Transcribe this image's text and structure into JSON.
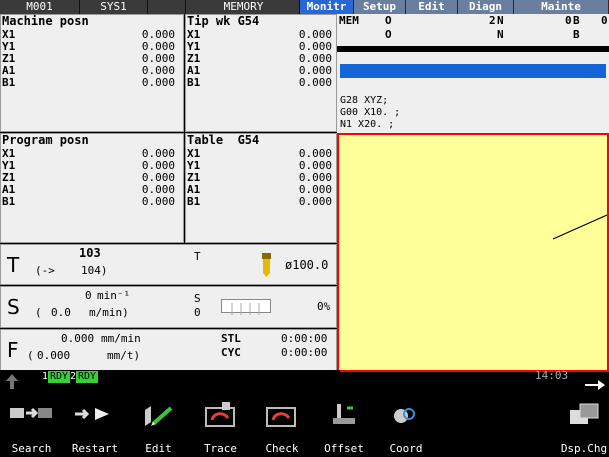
{
  "topbar": {
    "m_code": "M001",
    "sys": "SYS1",
    "memory": "MEMORY",
    "tabs": [
      "Monitr",
      "Setup",
      "Edit",
      "Diagn",
      "Mainte"
    ]
  },
  "machine_posn": {
    "title": "Machine posn",
    "rows": [
      {
        "axis": "X1",
        "value": "0.000"
      },
      {
        "axis": "Y1",
        "value": "0.000"
      },
      {
        "axis": "Z1",
        "value": "0.000"
      },
      {
        "axis": "A1",
        "value": "0.000"
      },
      {
        "axis": "B1",
        "value": "0.000"
      }
    ]
  },
  "tip_wk": {
    "title": "Tip wk G54",
    "rows": [
      {
        "axis": "X1",
        "value": "0.000"
      },
      {
        "axis": "Y1",
        "value": "0.000"
      },
      {
        "axis": "Z1",
        "value": "0.000"
      },
      {
        "axis": "A1",
        "value": "0.000"
      },
      {
        "axis": "B1",
        "value": "0.000"
      }
    ]
  },
  "program_posn": {
    "title": "Program posn",
    "rows": [
      {
        "axis": "X1",
        "value": "0.000"
      },
      {
        "axis": "Y1",
        "value": "0.000"
      },
      {
        "axis": "Z1",
        "value": "0.000"
      },
      {
        "axis": "A1",
        "value": "0.000"
      },
      {
        "axis": "B1",
        "value": "0.000"
      }
    ]
  },
  "table": {
    "title": "Table  G54",
    "rows": [
      {
        "axis": "X1",
        "value": "0.000"
      },
      {
        "axis": "Y1",
        "value": "0.000"
      },
      {
        "axis": "Z1",
        "value": "0.000"
      },
      {
        "axis": "A1",
        "value": "0.000"
      },
      {
        "axis": "B1",
        "value": "0.000"
      }
    ]
  },
  "status": {
    "mem": "MEM",
    "o1": "O",
    "n_num": "2",
    "n1": "N",
    "b_num": "0",
    "b1": "B",
    "extra": "0",
    "o2": "O",
    "n2": "N",
    "b2": "B"
  },
  "program": {
    "lines": [
      "G28 XYZ;",
      "G00 X10. ;",
      "N1 X20. ;"
    ]
  },
  "t_panel": {
    "letter": "T",
    "tool_no": "103",
    "next_prefix": "(->",
    "next_tool": "104)",
    "t_label": "T",
    "diameter": "ø100.0"
  },
  "s_panel": {
    "letter": "S",
    "speed": "0",
    "unit1": "min⁻¹",
    "paren": "(",
    "actual": "0.0",
    "unit2": "m/min)",
    "s_label": "S",
    "s_value": "0",
    "percent": "0%"
  },
  "f_panel": {
    "letter": "F",
    "feed": "0.000",
    "unit1": "mm/min",
    "paren": "(",
    "actual": "0.000",
    "unit2": "mm/t)",
    "stl_label": "STL",
    "stl_time": "0:00:00",
    "cyc_label": "CYC",
    "cyc_time": "0:00:00"
  },
  "rdy": {
    "n1": "1",
    "label1": "RDY",
    "n2": "2",
    "label2": "RDY"
  },
  "clock": "14:03",
  "fkeys": [
    "Search",
    "Restart",
    "Edit",
    "Trace",
    "Check",
    "Offset",
    "Coord",
    "",
    "",
    "Dsp.Chg"
  ]
}
